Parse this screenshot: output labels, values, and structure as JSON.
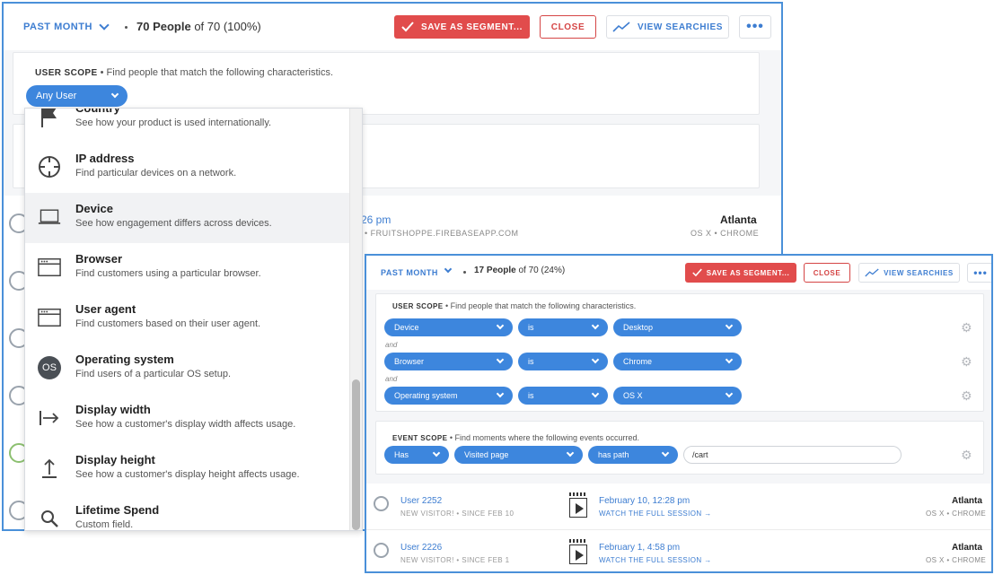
{
  "main": {
    "period": "PAST MONTH",
    "count_bold": "70 People",
    "count_rest": " of 70 (100%)",
    "save_label": "SAVE AS SEGMENT...",
    "close_label": "CLOSE",
    "view_label": "VIEW SEARCHIES",
    "more_label": "•••",
    "user_scope_label": "USER SCOPE",
    "user_scope_desc": " • Find people that match the following characteristics.",
    "any_user": "Any User",
    "row": {
      "time": "26 pm",
      "url": "• FRUITSHOPPE.FIREBASEAPP.COM",
      "city": "Atlanta",
      "os": "OS X • CHROME"
    }
  },
  "dropdown": {
    "items": [
      {
        "title": "Country",
        "desc": "See how your product is used internationally.",
        "icon": "flag-icon"
      },
      {
        "title": "IP address",
        "desc": "Find particular devices on a network.",
        "icon": "crosshair-icon"
      },
      {
        "title": "Device",
        "desc": "See how engagement differs across devices.",
        "icon": "laptop-icon"
      },
      {
        "title": "Browser",
        "desc": "Find customers using a particular browser.",
        "icon": "browser-window-icon"
      },
      {
        "title": "User agent",
        "desc": "Find customers based on their user agent.",
        "icon": "browser-window-icon"
      },
      {
        "title": "Operating system",
        "desc": "Find users of a particular OS setup.",
        "icon": "os-icon"
      },
      {
        "title": "Display width",
        "desc": "See how a customer's display width affects usage.",
        "icon": "arrow-right-bar-icon"
      },
      {
        "title": "Display height",
        "desc": "See how a customer's display height affects usage.",
        "icon": "arrow-up-bar-icon"
      },
      {
        "title": "Lifetime Spend",
        "desc": "Custom field.",
        "icon": "search-icon"
      }
    ],
    "os_badge": "OS"
  },
  "inset": {
    "period": "PAST MONTH",
    "count_bold": "17 People",
    "count_rest": " of 70 (24%)",
    "save_label": "SAVE AS SEGMENT...",
    "close_label": "CLOSE",
    "view_label": "VIEW SEARCHIES",
    "more_label": "•••",
    "user_scope_label": "USER SCOPE",
    "user_scope_desc": " • Find people that match the following characteristics.",
    "rules": [
      {
        "field": "Device",
        "op": "is",
        "value": "Desktop"
      },
      {
        "field": "Browser",
        "op": "is",
        "value": "Chrome"
      },
      {
        "field": "Operating system",
        "op": "is",
        "value": "OS X"
      }
    ],
    "and_label": "and",
    "event_scope_label": "EVENT SCOPE",
    "event_scope_desc": " • Find moments where the following events occurred.",
    "event": {
      "has": "Has",
      "event": "Visited page",
      "op": "has path",
      "value": "/cart"
    },
    "users": [
      {
        "name": "User 2252",
        "sub": "NEW VISITOR! • SINCE FEB 10",
        "date": "February 10, 12:28 pm",
        "watch": "WATCH THE FULL SESSION →",
        "city": "Atlanta",
        "os": "OS X • CHROME"
      },
      {
        "name": "User 2226",
        "sub": "NEW VISITOR! • SINCE FEB 1",
        "date": "February 1, 4:58 pm",
        "watch": "WATCH THE FULL SESSION →",
        "city": "Atlanta",
        "os": "OS X • CHROME"
      }
    ]
  },
  "colors": {
    "accent": "#3d86dd",
    "danger": "#e14c4c",
    "frame": "#4a90d9"
  }
}
